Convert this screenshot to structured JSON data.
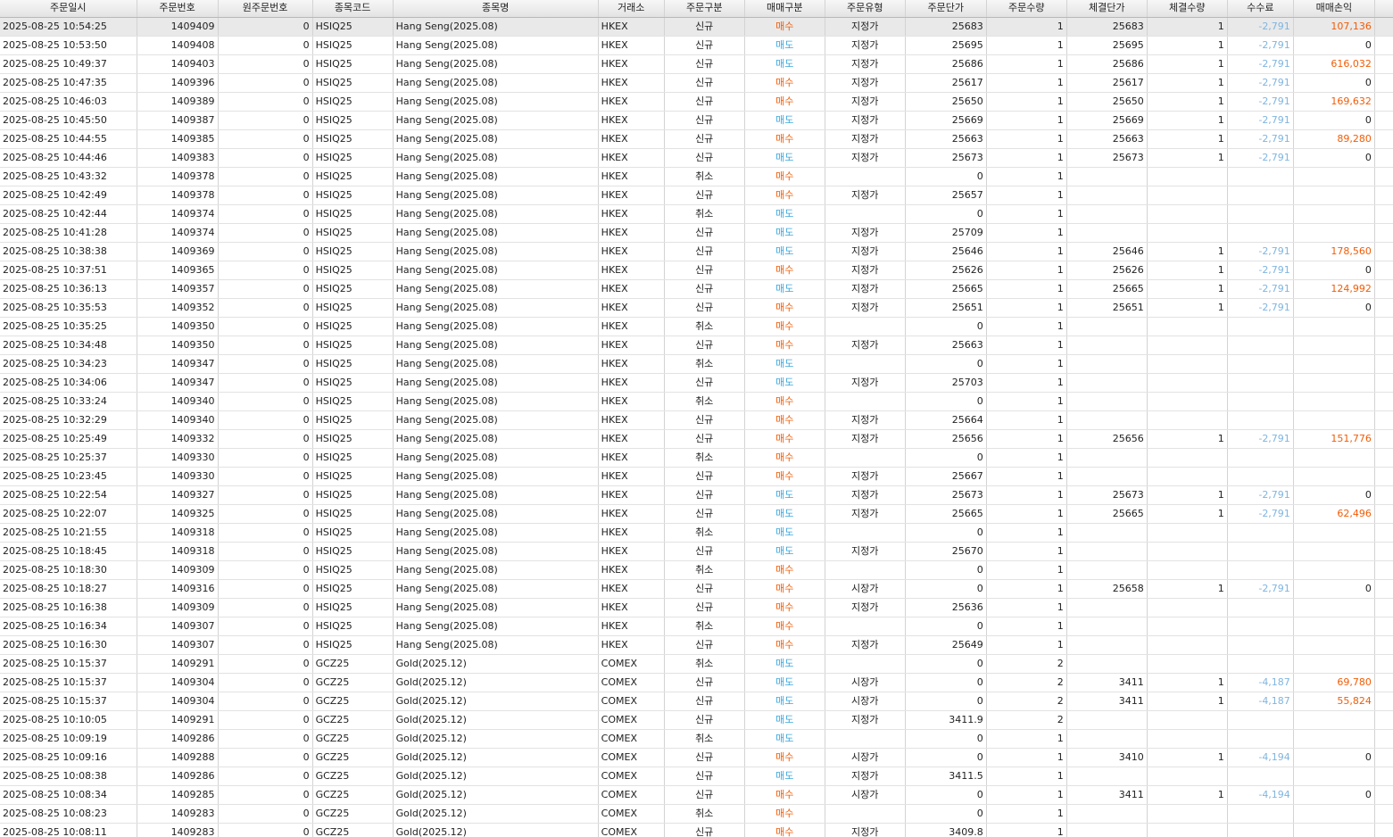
{
  "columns": [
    "주문일시",
    "주문번호",
    "원주문번호",
    "종목코드",
    "종목명",
    "거래소",
    "주문구분",
    "매매구분",
    "주문유형",
    "주문단가",
    "주문수량",
    "체결단가",
    "체결수량",
    "수수료",
    "매매손익",
    ""
  ],
  "colors": {
    "buy": "#f25c05",
    "sell": "#3ba7dd",
    "fee": "#7fb5e0",
    "profit": "#f25c05"
  },
  "rows": [
    [
      "2025-08-25 10:54:25",
      "1409409",
      "0",
      "HSIQ25",
      "Hang Seng(2025.08)",
      "HKEX",
      "신규",
      "매수",
      "지정가",
      "25683",
      "1",
      "25683",
      "1",
      "-2,791",
      "107,136"
    ],
    [
      "2025-08-25 10:53:50",
      "1409408",
      "0",
      "HSIQ25",
      "Hang Seng(2025.08)",
      "HKEX",
      "신규",
      "매도",
      "지정가",
      "25695",
      "1",
      "25695",
      "1",
      "-2,791",
      "0"
    ],
    [
      "2025-08-25 10:49:37",
      "1409403",
      "0",
      "HSIQ25",
      "Hang Seng(2025.08)",
      "HKEX",
      "신규",
      "매도",
      "지정가",
      "25686",
      "1",
      "25686",
      "1",
      "-2,791",
      "616,032"
    ],
    [
      "2025-08-25 10:47:35",
      "1409396",
      "0",
      "HSIQ25",
      "Hang Seng(2025.08)",
      "HKEX",
      "신규",
      "매수",
      "지정가",
      "25617",
      "1",
      "25617",
      "1",
      "-2,791",
      "0"
    ],
    [
      "2025-08-25 10:46:03",
      "1409389",
      "0",
      "HSIQ25",
      "Hang Seng(2025.08)",
      "HKEX",
      "신규",
      "매수",
      "지정가",
      "25650",
      "1",
      "25650",
      "1",
      "-2,791",
      "169,632"
    ],
    [
      "2025-08-25 10:45:50",
      "1409387",
      "0",
      "HSIQ25",
      "Hang Seng(2025.08)",
      "HKEX",
      "신규",
      "매도",
      "지정가",
      "25669",
      "1",
      "25669",
      "1",
      "-2,791",
      "0"
    ],
    [
      "2025-08-25 10:44:55",
      "1409385",
      "0",
      "HSIQ25",
      "Hang Seng(2025.08)",
      "HKEX",
      "신규",
      "매수",
      "지정가",
      "25663",
      "1",
      "25663",
      "1",
      "-2,791",
      "89,280"
    ],
    [
      "2025-08-25 10:44:46",
      "1409383",
      "0",
      "HSIQ25",
      "Hang Seng(2025.08)",
      "HKEX",
      "신규",
      "매도",
      "지정가",
      "25673",
      "1",
      "25673",
      "1",
      "-2,791",
      "0"
    ],
    [
      "2025-08-25 10:43:32",
      "1409378",
      "0",
      "HSIQ25",
      "Hang Seng(2025.08)",
      "HKEX",
      "취소",
      "매수",
      "",
      "0",
      "1",
      "",
      "",
      "",
      ""
    ],
    [
      "2025-08-25 10:42:49",
      "1409378",
      "0",
      "HSIQ25",
      "Hang Seng(2025.08)",
      "HKEX",
      "신규",
      "매수",
      "지정가",
      "25657",
      "1",
      "",
      "",
      "",
      ""
    ],
    [
      "2025-08-25 10:42:44",
      "1409374",
      "0",
      "HSIQ25",
      "Hang Seng(2025.08)",
      "HKEX",
      "취소",
      "매도",
      "",
      "0",
      "1",
      "",
      "",
      "",
      ""
    ],
    [
      "2025-08-25 10:41:28",
      "1409374",
      "0",
      "HSIQ25",
      "Hang Seng(2025.08)",
      "HKEX",
      "신규",
      "매도",
      "지정가",
      "25709",
      "1",
      "",
      "",
      "",
      ""
    ],
    [
      "2025-08-25 10:38:38",
      "1409369",
      "0",
      "HSIQ25",
      "Hang Seng(2025.08)",
      "HKEX",
      "신규",
      "매도",
      "지정가",
      "25646",
      "1",
      "25646",
      "1",
      "-2,791",
      "178,560"
    ],
    [
      "2025-08-25 10:37:51",
      "1409365",
      "0",
      "HSIQ25",
      "Hang Seng(2025.08)",
      "HKEX",
      "신규",
      "매수",
      "지정가",
      "25626",
      "1",
      "25626",
      "1",
      "-2,791",
      "0"
    ],
    [
      "2025-08-25 10:36:13",
      "1409357",
      "0",
      "HSIQ25",
      "Hang Seng(2025.08)",
      "HKEX",
      "신규",
      "매도",
      "지정가",
      "25665",
      "1",
      "25665",
      "1",
      "-2,791",
      "124,992"
    ],
    [
      "2025-08-25 10:35:53",
      "1409352",
      "0",
      "HSIQ25",
      "Hang Seng(2025.08)",
      "HKEX",
      "신규",
      "매수",
      "지정가",
      "25651",
      "1",
      "25651",
      "1",
      "-2,791",
      "0"
    ],
    [
      "2025-08-25 10:35:25",
      "1409350",
      "0",
      "HSIQ25",
      "Hang Seng(2025.08)",
      "HKEX",
      "취소",
      "매수",
      "",
      "0",
      "1",
      "",
      "",
      "",
      ""
    ],
    [
      "2025-08-25 10:34:48",
      "1409350",
      "0",
      "HSIQ25",
      "Hang Seng(2025.08)",
      "HKEX",
      "신규",
      "매수",
      "지정가",
      "25663",
      "1",
      "",
      "",
      "",
      ""
    ],
    [
      "2025-08-25 10:34:23",
      "1409347",
      "0",
      "HSIQ25",
      "Hang Seng(2025.08)",
      "HKEX",
      "취소",
      "매도",
      "",
      "0",
      "1",
      "",
      "",
      "",
      ""
    ],
    [
      "2025-08-25 10:34:06",
      "1409347",
      "0",
      "HSIQ25",
      "Hang Seng(2025.08)",
      "HKEX",
      "신규",
      "매도",
      "지정가",
      "25703",
      "1",
      "",
      "",
      "",
      ""
    ],
    [
      "2025-08-25 10:33:24",
      "1409340",
      "0",
      "HSIQ25",
      "Hang Seng(2025.08)",
      "HKEX",
      "취소",
      "매수",
      "",
      "0",
      "1",
      "",
      "",
      "",
      ""
    ],
    [
      "2025-08-25 10:32:29",
      "1409340",
      "0",
      "HSIQ25",
      "Hang Seng(2025.08)",
      "HKEX",
      "신규",
      "매수",
      "지정가",
      "25664",
      "1",
      "",
      "",
      "",
      ""
    ],
    [
      "2025-08-25 10:25:49",
      "1409332",
      "0",
      "HSIQ25",
      "Hang Seng(2025.08)",
      "HKEX",
      "신규",
      "매수",
      "지정가",
      "25656",
      "1",
      "25656",
      "1",
      "-2,791",
      "151,776"
    ],
    [
      "2025-08-25 10:25:37",
      "1409330",
      "0",
      "HSIQ25",
      "Hang Seng(2025.08)",
      "HKEX",
      "취소",
      "매수",
      "",
      "0",
      "1",
      "",
      "",
      "",
      ""
    ],
    [
      "2025-08-25 10:23:45",
      "1409330",
      "0",
      "HSIQ25",
      "Hang Seng(2025.08)",
      "HKEX",
      "신규",
      "매수",
      "지정가",
      "25667",
      "1",
      "",
      "",
      "",
      ""
    ],
    [
      "2025-08-25 10:22:54",
      "1409327",
      "0",
      "HSIQ25",
      "Hang Seng(2025.08)",
      "HKEX",
      "신규",
      "매도",
      "지정가",
      "25673",
      "1",
      "25673",
      "1",
      "-2,791",
      "0"
    ],
    [
      "2025-08-25 10:22:07",
      "1409325",
      "0",
      "HSIQ25",
      "Hang Seng(2025.08)",
      "HKEX",
      "신규",
      "매도",
      "지정가",
      "25665",
      "1",
      "25665",
      "1",
      "-2,791",
      "62,496"
    ],
    [
      "2025-08-25 10:21:55",
      "1409318",
      "0",
      "HSIQ25",
      "Hang Seng(2025.08)",
      "HKEX",
      "취소",
      "매도",
      "",
      "0",
      "1",
      "",
      "",
      "",
      ""
    ],
    [
      "2025-08-25 10:18:45",
      "1409318",
      "0",
      "HSIQ25",
      "Hang Seng(2025.08)",
      "HKEX",
      "신규",
      "매도",
      "지정가",
      "25670",
      "1",
      "",
      "",
      "",
      ""
    ],
    [
      "2025-08-25 10:18:30",
      "1409309",
      "0",
      "HSIQ25",
      "Hang Seng(2025.08)",
      "HKEX",
      "취소",
      "매수",
      "",
      "0",
      "1",
      "",
      "",
      "",
      ""
    ],
    [
      "2025-08-25 10:18:27",
      "1409316",
      "0",
      "HSIQ25",
      "Hang Seng(2025.08)",
      "HKEX",
      "신규",
      "매수",
      "시장가",
      "0",
      "1",
      "25658",
      "1",
      "-2,791",
      "0"
    ],
    [
      "2025-08-25 10:16:38",
      "1409309",
      "0",
      "HSIQ25",
      "Hang Seng(2025.08)",
      "HKEX",
      "신규",
      "매수",
      "지정가",
      "25636",
      "1",
      "",
      "",
      "",
      ""
    ],
    [
      "2025-08-25 10:16:34",
      "1409307",
      "0",
      "HSIQ25",
      "Hang Seng(2025.08)",
      "HKEX",
      "취소",
      "매수",
      "",
      "0",
      "1",
      "",
      "",
      "",
      ""
    ],
    [
      "2025-08-25 10:16:30",
      "1409307",
      "0",
      "HSIQ25",
      "Hang Seng(2025.08)",
      "HKEX",
      "신규",
      "매수",
      "지정가",
      "25649",
      "1",
      "",
      "",
      "",
      ""
    ],
    [
      "2025-08-25 10:15:37",
      "1409291",
      "0",
      "GCZ25",
      "Gold(2025.12)",
      "COMEX",
      "취소",
      "매도",
      "",
      "0",
      "2",
      "",
      "",
      "",
      ""
    ],
    [
      "2025-08-25 10:15:37",
      "1409304",
      "0",
      "GCZ25",
      "Gold(2025.12)",
      "COMEX",
      "신규",
      "매도",
      "시장가",
      "0",
      "2",
      "3411",
      "1",
      "-4,187",
      "69,780"
    ],
    [
      "2025-08-25 10:15:37",
      "1409304",
      "0",
      "GCZ25",
      "Gold(2025.12)",
      "COMEX",
      "신규",
      "매도",
      "시장가",
      "0",
      "2",
      "3411",
      "1",
      "-4,187",
      "55,824"
    ],
    [
      "2025-08-25 10:10:05",
      "1409291",
      "0",
      "GCZ25",
      "Gold(2025.12)",
      "COMEX",
      "신규",
      "매도",
      "지정가",
      "3411.9",
      "2",
      "",
      "",
      "",
      ""
    ],
    [
      "2025-08-25 10:09:19",
      "1409286",
      "0",
      "GCZ25",
      "Gold(2025.12)",
      "COMEX",
      "취소",
      "매도",
      "",
      "0",
      "1",
      "",
      "",
      "",
      ""
    ],
    [
      "2025-08-25 10:09:16",
      "1409288",
      "0",
      "GCZ25",
      "Gold(2025.12)",
      "COMEX",
      "신규",
      "매수",
      "시장가",
      "0",
      "1",
      "3410",
      "1",
      "-4,194",
      "0"
    ],
    [
      "2025-08-25 10:08:38",
      "1409286",
      "0",
      "GCZ25",
      "Gold(2025.12)",
      "COMEX",
      "신규",
      "매도",
      "지정가",
      "3411.5",
      "1",
      "",
      "",
      "",
      ""
    ],
    [
      "2025-08-25 10:08:34",
      "1409285",
      "0",
      "GCZ25",
      "Gold(2025.12)",
      "COMEX",
      "신규",
      "매수",
      "시장가",
      "0",
      "1",
      "3411",
      "1",
      "-4,194",
      "0"
    ],
    [
      "2025-08-25 10:08:23",
      "1409283",
      "0",
      "GCZ25",
      "Gold(2025.12)",
      "COMEX",
      "취소",
      "매수",
      "",
      "0",
      "1",
      "",
      "",
      "",
      ""
    ],
    [
      "2025-08-25 10:08:11",
      "1409283",
      "0",
      "GCZ25",
      "Gold(2025.12)",
      "COMEX",
      "신규",
      "매수",
      "지정가",
      "3409.8",
      "1",
      "",
      "",
      "",
      ""
    ]
  ]
}
